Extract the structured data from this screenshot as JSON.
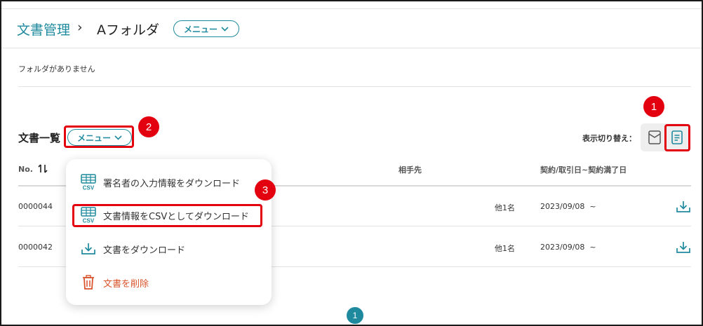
{
  "header": {
    "root": "文書管理",
    "separator": "›",
    "folder": "Aフォルダ",
    "menu_label": "メニュー"
  },
  "folders_empty": "フォルダがありません",
  "list": {
    "title": "文書一覧",
    "menu_label": "メニュー",
    "view_toggle_label": "表示切り替え："
  },
  "table": {
    "headers": [
      "No.",
      "相手先",
      "契約/取引日~契約満了日"
    ],
    "rows": [
      {
        "no": "0000044",
        "others": "他1名",
        "date": "2023/09/08  ~"
      },
      {
        "no": "0000042",
        "others": "他1名",
        "date": "2023/09/08  ~"
      }
    ]
  },
  "dropdown": {
    "items": [
      {
        "label": "署名者の入力情報をダウンロード",
        "icon": "csv-icon"
      },
      {
        "label": "文書情報をCSVとしてダウンロード",
        "icon": "csv-icon"
      },
      {
        "label": "文書をダウンロード",
        "icon": "download-icon"
      },
      {
        "label": "文書を削除",
        "icon": "trash-icon"
      }
    ]
  },
  "badges": [
    "1",
    "2",
    "3"
  ],
  "pagination": {
    "current": "1"
  },
  "colors": {
    "accent": "#1f8a9e",
    "highlight": "#e3000f",
    "danger": "#d9532b"
  }
}
